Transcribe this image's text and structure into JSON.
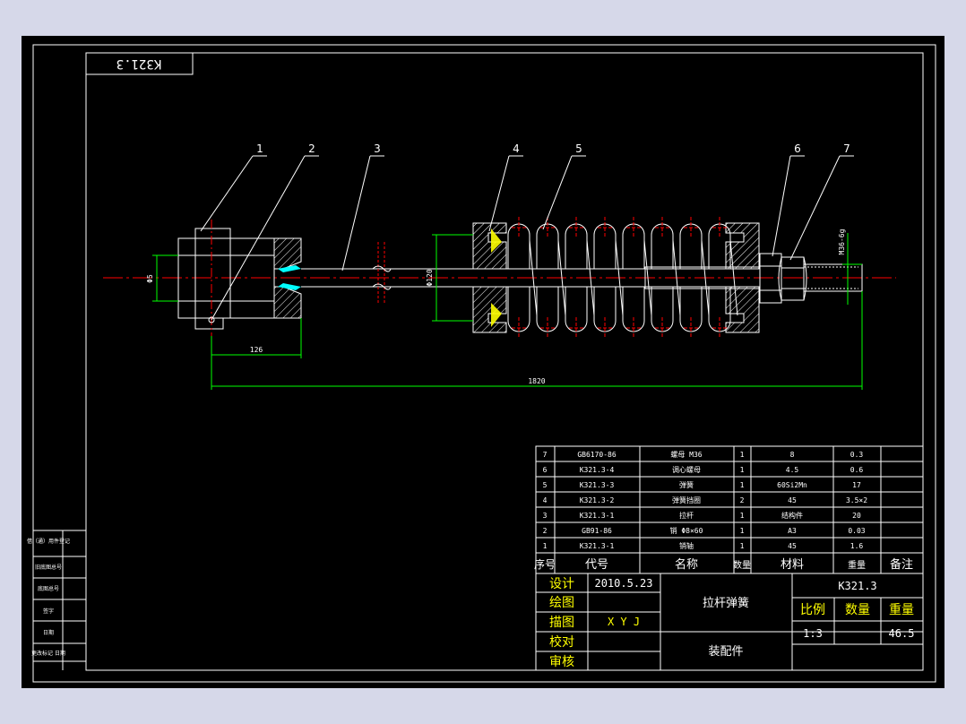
{
  "drawing_code": "K321.3",
  "balloons": [
    "1",
    "2",
    "3",
    "4",
    "5",
    "6",
    "7"
  ],
  "dimensions": {
    "pin_dia": "Φ5",
    "spring_seat_dia": "Φ120",
    "thread_spec": "M36-6g",
    "offset": "126",
    "overall_length": "1820"
  },
  "parts_list": {
    "headers": [
      "序号",
      "代号",
      "名称",
      "数量",
      "材料",
      "重量",
      "备注"
    ],
    "rows": [
      [
        "7",
        "GB6170-86",
        "螺母 M36",
        "1",
        "8",
        "0.3",
        ""
      ],
      [
        "6",
        "K321.3-4",
        "调心螺母",
        "1",
        "4.5",
        "0.6",
        ""
      ],
      [
        "5",
        "K321.3-3",
        "弹簧",
        "1",
        "60Si2Mn",
        "17",
        ""
      ],
      [
        "4",
        "K321.3-2",
        "弹簧挡圈",
        "2",
        "45",
        "3.5×2",
        ""
      ],
      [
        "3",
        "K321.3-1",
        "拉杆",
        "1",
        "结构件",
        "20",
        ""
      ],
      [
        "2",
        "GB91-86",
        "销 Φ8×60",
        "1",
        "A3",
        "0.03",
        ""
      ],
      [
        "1",
        "K321.3-1",
        "销轴",
        "1",
        "45",
        "1.6",
        ""
      ]
    ]
  },
  "title_block": {
    "roles": [
      "设计",
      "绘图",
      "描图",
      "校对",
      "审核"
    ],
    "design_date": "2010.5.23",
    "tracer": "X Y J",
    "name": "拉杆弹簧",
    "code": "K321.3",
    "scale_label": "比例",
    "qty_label": "数量",
    "weight_label": "重量",
    "scale": "1:3",
    "qty": "",
    "weight": "46.5",
    "doc_type": "装配件"
  },
  "side_block": [
    "借（通）用件登记",
    "旧底图总号",
    "底图总号",
    "签字",
    "日期",
    "更改标记 日期"
  ],
  "colors": {
    "background": "#000000",
    "line": "#ffffff",
    "dimension": "#00ff00",
    "centerline": "#ff0000",
    "section_fill": "#ffff00",
    "cyan_fill": "#00ffff",
    "table_header_text": "#ffff00"
  }
}
